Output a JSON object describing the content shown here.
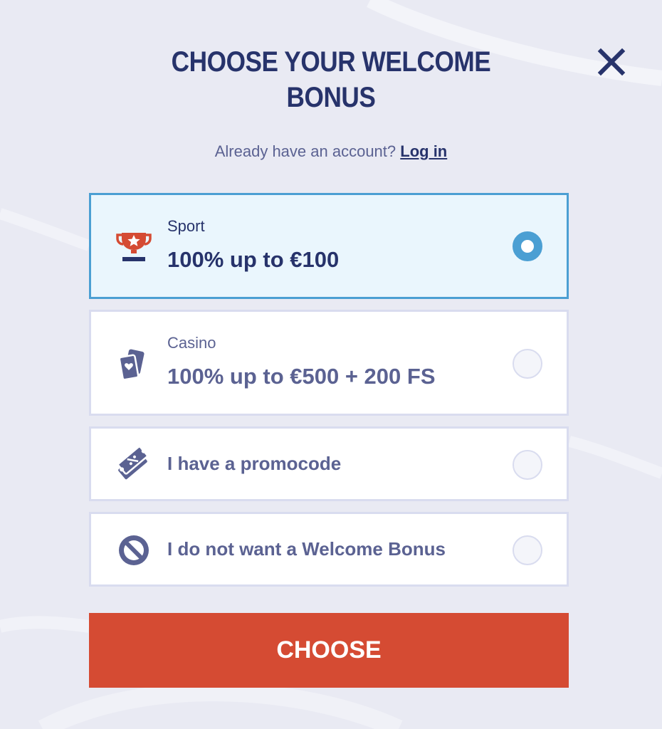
{
  "header": {
    "title_line1": "CHOOSE YOUR WELCOME",
    "title_line2": "BONUS",
    "close_icon": "close-icon"
  },
  "login_prompt": {
    "text": "Already have an account?",
    "link_label": "Log in"
  },
  "options": [
    {
      "id": "sport",
      "icon": "trophy-icon",
      "category": "Sport",
      "offer": "100% up to €100",
      "selected": true
    },
    {
      "id": "casino",
      "icon": "playing-cards-icon",
      "category": "Casino",
      "offer": "100% up to €500 + 200 FS",
      "selected": false
    },
    {
      "id": "promocode",
      "icon": "ticket-icon",
      "label": "I have a promocode",
      "selected": false
    },
    {
      "id": "no-bonus",
      "icon": "no-entry-icon",
      "label": "I do not want a Welcome Bonus",
      "selected": false
    }
  ],
  "footer": {
    "choose_label": "CHOOSE"
  },
  "colors": {
    "background": "#e9eaf3",
    "title": "#27336b",
    "muted_text": "#5b6292",
    "selected_border": "#4b9fd3",
    "selected_bg": "#eaf6fd",
    "accent_red": "#d54b33"
  }
}
